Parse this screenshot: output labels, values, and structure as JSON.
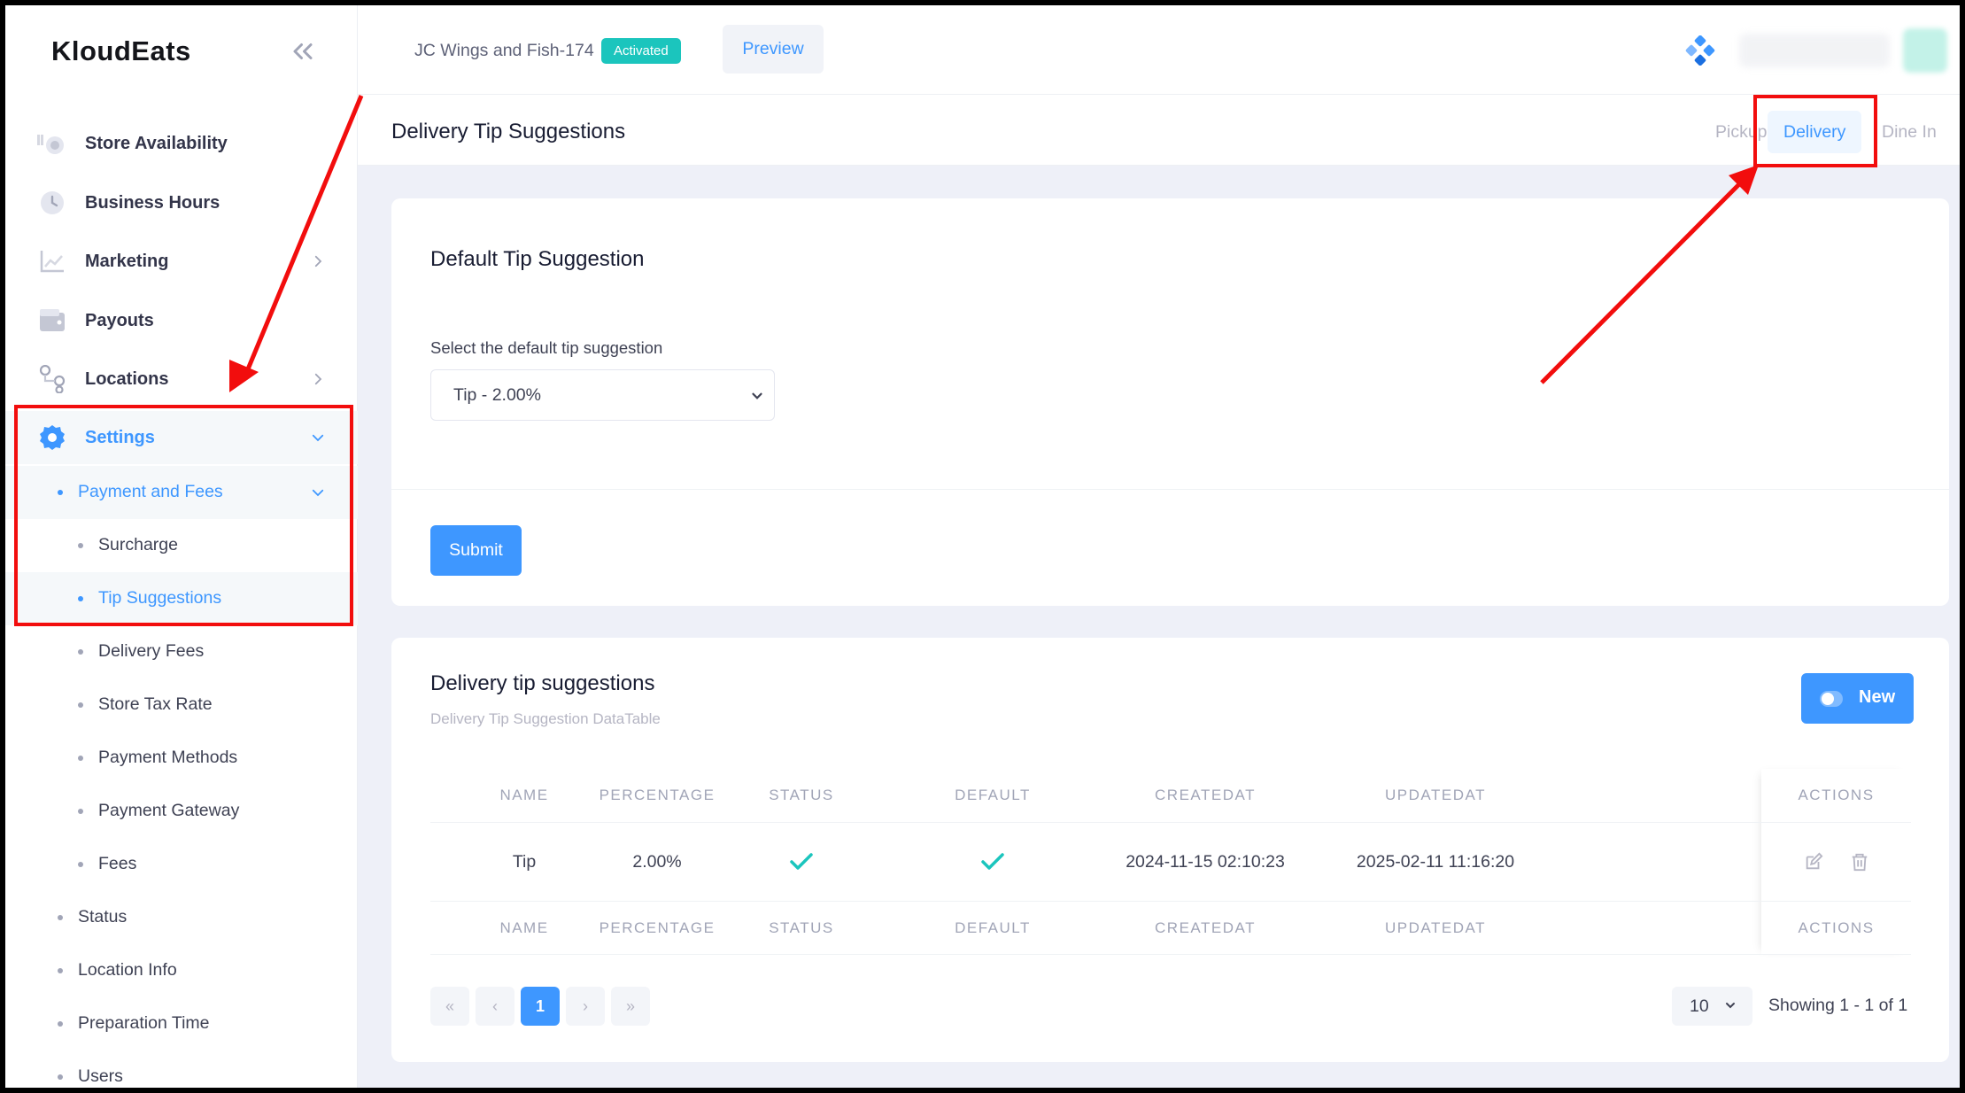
{
  "sidebar": {
    "brand": "KloudEats",
    "items": [
      {
        "label": "Store Availability",
        "icon": "store-icon"
      },
      {
        "label": "Business Hours",
        "icon": "clock-icon"
      },
      {
        "label": "Marketing",
        "icon": "chart-icon"
      },
      {
        "label": "Payouts",
        "icon": "wallet-icon"
      },
      {
        "label": "Locations",
        "icon": "locations-icon"
      },
      {
        "label": "Settings",
        "icon": "gear-icon"
      }
    ],
    "settings_children": [
      "Payment and Fees",
      "Surcharge",
      "Tip Suggestions",
      "Delivery Fees",
      "Store Tax Rate",
      "Payment Methods",
      "Payment Gateway",
      "Fees",
      "Status",
      "Location Info",
      "Preparation Time",
      "Users"
    ]
  },
  "header": {
    "store_name": "JC Wings and Fish-174",
    "status_badge": "Activated",
    "preview_label": "Preview"
  },
  "toolbar": {
    "page_title": "Delivery Tip Suggestions",
    "tabs": [
      "Pickup",
      "Delivery",
      "Dine In"
    ],
    "active_tab": "Delivery"
  },
  "default_tip": {
    "title": "Default Tip Suggestion",
    "field_label": "Select the default tip suggestion",
    "selected_value": "Tip - 2.00%",
    "submit_label": "Submit"
  },
  "table_card": {
    "title": "Delivery tip suggestions",
    "subtitle": "Delivery Tip Suggestion DataTable",
    "new_label": "New",
    "columns": [
      "NAME",
      "PERCENTAGE",
      "STATUS",
      "DEFAULT",
      "CREATEDAT",
      "UPDATEDAT",
      "ACTIONS"
    ],
    "rows": [
      {
        "name": "Tip",
        "percentage": "2.00%",
        "status": true,
        "default": true,
        "createdat": "2024-11-15 02:10:23",
        "updatedat": "2025-02-11 11:16:20"
      }
    ],
    "pagination": {
      "first": "«",
      "prev": "‹",
      "current_page": "1",
      "next": "›",
      "last": "»",
      "per_page": "10",
      "showing": "Showing 1 - 1 of 1"
    }
  },
  "colors": {
    "accent": "#3e97ff",
    "activated": "#1bc5bd",
    "check": "#1bc5bd",
    "annotation": "#f20d0d"
  }
}
